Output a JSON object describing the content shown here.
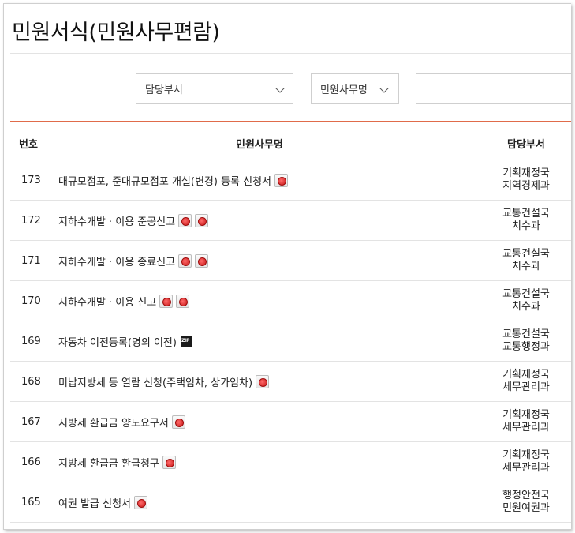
{
  "page": {
    "title": "민원서식(민원사무편람)"
  },
  "filters": {
    "department_select": "담당부서",
    "affair_select": "민원사무명",
    "search_placeholder": ""
  },
  "table": {
    "headers": {
      "number": "번호",
      "name": "민원사무명",
      "department": "담당부서"
    },
    "rows": [
      {
        "number": "173",
        "name": "대규모점포, 준대규모점포 개설(변경) 등록 신청서",
        "icons": [
          "pdf-file-icon"
        ],
        "dept1": "기획재정국",
        "dept2": "지역경제과"
      },
      {
        "number": "172",
        "name": "지하수개발 · 이용 준공신고",
        "icons": [
          "pdf-file-icon",
          "pdf-file-icon"
        ],
        "dept1": "교통건설국",
        "dept2": "치수과"
      },
      {
        "number": "171",
        "name": "지하수개발 · 이용 종료신고",
        "icons": [
          "pdf-file-icon",
          "pdf-file-icon"
        ],
        "dept1": "교통건설국",
        "dept2": "치수과"
      },
      {
        "number": "170",
        "name": "지하수개발 · 이용 신고",
        "icons": [
          "pdf-file-icon",
          "pdf-file-icon"
        ],
        "dept1": "교통건설국",
        "dept2": "치수과"
      },
      {
        "number": "169",
        "name": "자동차 이전등록(명의 이전)",
        "icons": [
          "zip-file-icon"
        ],
        "dept1": "교통건설국",
        "dept2": "교통행정과"
      },
      {
        "number": "168",
        "name": "미납지방세 등 열람 신청(주택임차, 상가임차)",
        "icons": [
          "pdf-file-icon"
        ],
        "dept1": "기획재정국",
        "dept2": "세무관리과"
      },
      {
        "number": "167",
        "name": "지방세 환급금 양도요구서",
        "icons": [
          "pdf-file-icon"
        ],
        "dept1": "기획재정국",
        "dept2": "세무관리과"
      },
      {
        "number": "166",
        "name": "지방세 환급금 환급청구",
        "icons": [
          "pdf-file-icon"
        ],
        "dept1": "기획재정국",
        "dept2": "세무관리과"
      },
      {
        "number": "165",
        "name": "여권 발급 신청서",
        "icons": [
          "pdf-file-icon"
        ],
        "dept1": "행정안전국",
        "dept2": "민원여권과"
      }
    ]
  }
}
